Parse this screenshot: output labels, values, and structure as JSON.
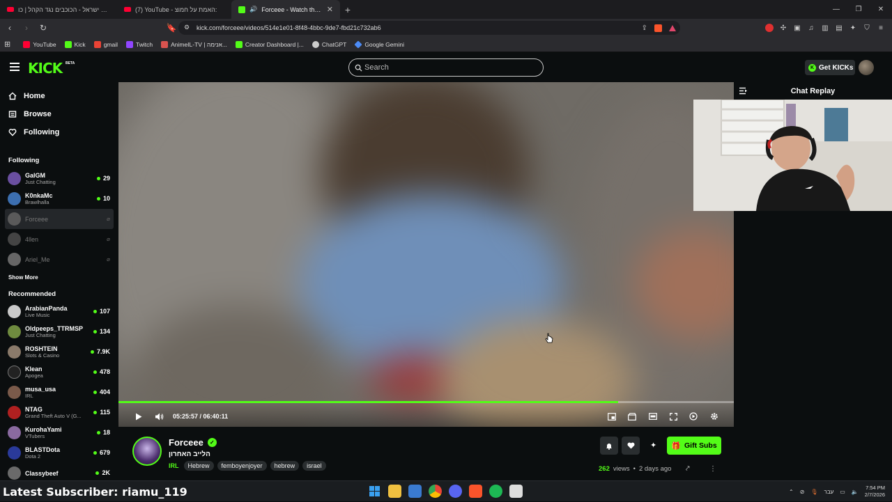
{
  "browser": {
    "tabs": [
      {
        "title": "איוונט ישראל - הכוכבים נגד הקהל | כו",
        "active": false
      },
      {
        "title": "(7) YouTube - האמת על חמוצ:",
        "active": false
      },
      {
        "title": "Forceee - Watch the VOD on",
        "active": true
      }
    ],
    "new_tab": "+",
    "url": "kick.com/forceee/videos/514e1e01-8f48-4bbc-9de7-fbd21c732ab6",
    "bookmarks": [
      {
        "label": "YouTube",
        "color": "#ff0033"
      },
      {
        "label": "Kick",
        "color": "#53fc18"
      },
      {
        "label": "gmail",
        "color": "#ea4335"
      },
      {
        "label": "Twitch",
        "color": "#9146ff"
      },
      {
        "label": "AnimeIL-TV | אנימה...",
        "color": "#d9534f"
      },
      {
        "label": "Creator Dashboard |...",
        "color": "#53fc18"
      },
      {
        "label": "ChatGPT",
        "color": "#cccccc"
      },
      {
        "label": "Google Gemini",
        "color": "#4c8bf5"
      }
    ]
  },
  "kick": {
    "logo": "KICK",
    "beta": "BETA",
    "search_placeholder": "Search",
    "get_kicks": "Get KICKs",
    "accent": "#53fc18"
  },
  "sidebar": {
    "nav": [
      {
        "label": "Home",
        "icon": "home-icon"
      },
      {
        "label": "Browse",
        "icon": "browse-icon"
      },
      {
        "label": "Following",
        "icon": "heart-icon"
      }
    ],
    "following_header": "Following",
    "following": [
      {
        "name": "GalGM",
        "category": "Just Chatting",
        "viewers": "29",
        "live": true,
        "color": "#6a4fa0"
      },
      {
        "name": "K0nkaMc",
        "category": "Brawlhalla",
        "viewers": "10",
        "live": true,
        "color": "#3c6fb0"
      },
      {
        "name": "Forceee",
        "category": "",
        "viewers": "",
        "live": false,
        "color": "#5a5a5a"
      },
      {
        "name": "4llen",
        "category": "",
        "viewers": "",
        "live": false,
        "color": "#444"
      },
      {
        "name": "Ariel_Me",
        "category": "",
        "viewers": "",
        "live": false,
        "color": "#666"
      }
    ],
    "show_more": "Show More",
    "recommended_header": "Recommended",
    "recommended": [
      {
        "name": "ArabianPanda",
        "category": "Live Music",
        "viewers": "107",
        "color": "#c9c9c9"
      },
      {
        "name": "Oldpeeps_TTRMSP",
        "category": "Just Chatting",
        "viewers": "134",
        "color": "#6f8b3f"
      },
      {
        "name": "ROSHTEIN",
        "category": "Slots & Casino",
        "viewers": "7.9K",
        "color": "#8a7a6a"
      },
      {
        "name": "Klean",
        "category": "Apogea",
        "viewers": "478",
        "color": "#222"
      },
      {
        "name": "musa_usa",
        "category": "IRL",
        "viewers": "404",
        "color": "#7a5a4a"
      },
      {
        "name": "NTAG",
        "category": "Grand Theft Auto V (G...",
        "viewers": "115",
        "color": "#b02020"
      },
      {
        "name": "KurohaYami",
        "category": "VTubers",
        "viewers": "18",
        "color": "#8a6aa0"
      },
      {
        "name": "BLASTDota",
        "category": "Dota 2",
        "viewers": "679",
        "color": "#2a3a9a"
      },
      {
        "name": "Classybeef",
        "category": "",
        "viewers": "2K",
        "color": "#6a6a6a"
      }
    ]
  },
  "player": {
    "time_current": "05:25:57",
    "time_total": "06:40:11",
    "progress": 0.812
  },
  "chat": {
    "title": "Chat Replay"
  },
  "channel": {
    "name": "Forceee",
    "stream_title": "הלייב האחרון",
    "category": "IRL",
    "tags": [
      "Hebrew",
      "femboyenjoyer",
      "hebrew",
      "israel"
    ],
    "gift_subs": "Gift Subs",
    "views_count": "262",
    "views_label": "views",
    "separator": "•",
    "uploaded": "2 days ago"
  },
  "taskbar": {
    "overlay": "Latest Subscriber: riamu_119",
    "lang": "עבר",
    "time": "7:54 PM",
    "date": "2/7/2026"
  }
}
